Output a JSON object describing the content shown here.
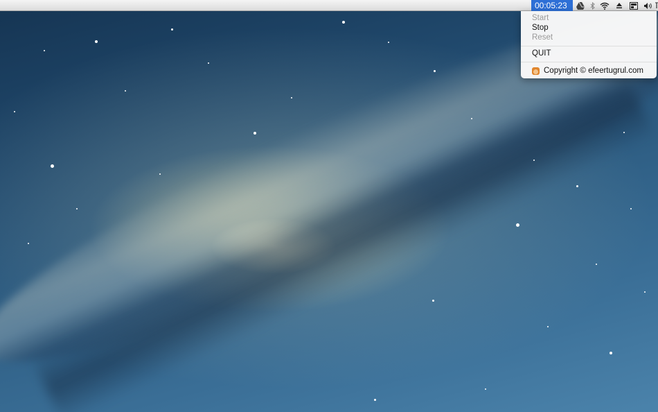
{
  "menubar": {
    "timer_value": "00:05:23",
    "status_icons": [
      "google-drive-icon",
      "bluetooth-icon",
      "wifi-icon",
      "eject-icon",
      "display-icon",
      "volume-icon"
    ]
  },
  "timer_menu": {
    "start_label": "Start",
    "stop_label": "Stop",
    "reset_label": "Reset",
    "quit_label": "QUIT",
    "copyright_label": "Copyright © efeertugrul.com"
  },
  "colors": {
    "menubar_highlight": "#2d6fd6",
    "disabled_text": "#9a9a9a"
  }
}
